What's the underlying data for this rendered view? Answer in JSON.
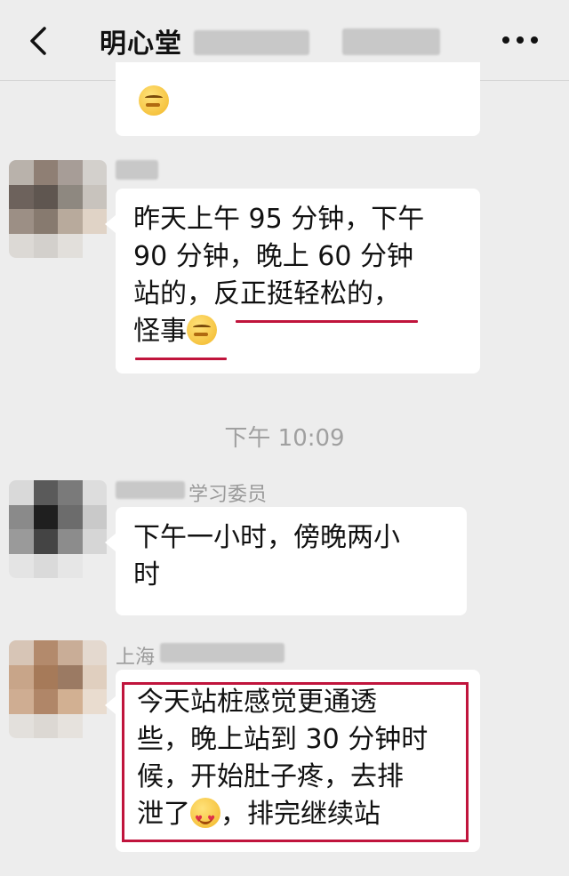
{
  "header": {
    "title": "明心堂",
    "back_icon": "chevron-left-icon",
    "more_icon": "more-dots-icon"
  },
  "messages": [
    {
      "sender": "",
      "text": "",
      "emoji": "thinking"
    },
    {
      "sender": "",
      "lines": [
        "昨天上午 95 分钟，下午",
        "90 分钟，晚上 60 分钟",
        "站的，反正挺轻松的，",
        "怪事"
      ],
      "emoji": "thinking"
    },
    {
      "sender": "学习委员",
      "lines": [
        "下午一小时，傍晚两小",
        "时"
      ]
    },
    {
      "sender": "上海",
      "lines": [
        "今天站桩感觉更通透",
        "些，晚上站到 30 分钟时",
        "候，开始肚子疼，去排",
        "泄了",
        "，排完继续站"
      ],
      "emoji": "smiling-heart-eyes"
    }
  ],
  "timestamp": "下午 10:09",
  "colors": {
    "background": "#ededed",
    "bubble": "#ffffff",
    "highlight": "#c0143c"
  }
}
